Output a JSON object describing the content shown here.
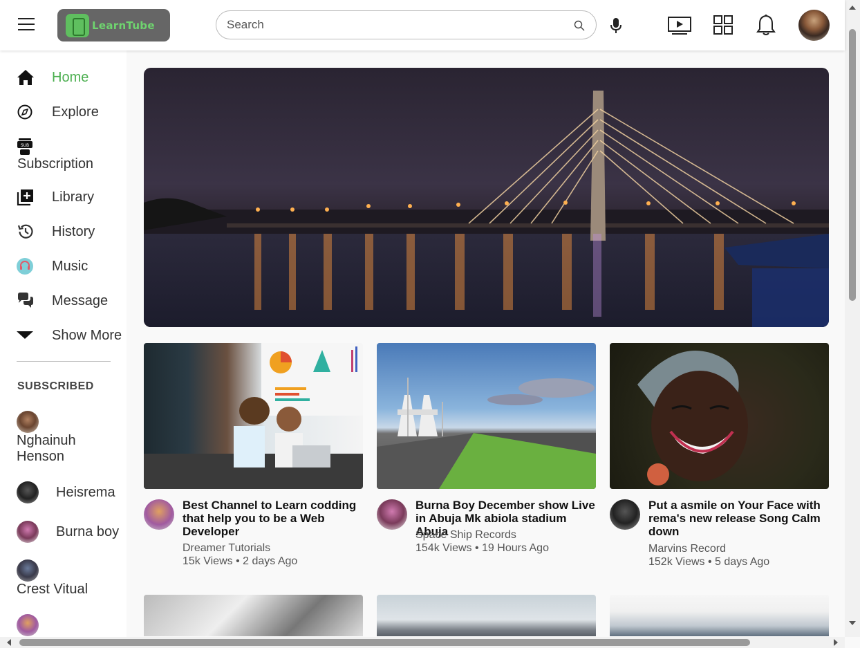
{
  "header": {
    "logo_text": "LearnTube",
    "search_placeholder": "Search"
  },
  "sidebar": {
    "items": [
      {
        "label": "Home",
        "icon": "home-icon",
        "active": true
      },
      {
        "label": "Explore",
        "icon": "compass-icon"
      },
      {
        "label": "Subscription",
        "icon": "subscription-icon"
      },
      {
        "label": "Library",
        "icon": "library-add-icon"
      },
      {
        "label": "History",
        "icon": "history-icon"
      },
      {
        "label": "Music",
        "icon": "headphones-icon"
      },
      {
        "label": "Message",
        "icon": "chat-icon"
      },
      {
        "label": "Show More",
        "icon": "caret-down-icon"
      }
    ],
    "subscribed_title": "SUBSCRIBED",
    "subscriptions": [
      {
        "name": "Nghainuh Henson"
      },
      {
        "name": "Heisrema"
      },
      {
        "name": "Burna boy"
      },
      {
        "name": "Crest Vitual"
      }
    ]
  },
  "videos": [
    {
      "title": "Best Channel to Learn codding that help you to be a Web Developer",
      "channel": "Dreamer Tutorials",
      "meta": "15k Views • 2 days Ago"
    },
    {
      "title": "Burna Boy December show Live in Abuja Mk abiola stadium Abuja",
      "channel": "Space Ship Records",
      "meta": "154k Views • 19 Hours Ago"
    },
    {
      "title": "Put a asmile on Your Face with rema's new release Song Calm down",
      "channel": "Marvins Record",
      "meta": "152k Views • 5 days Ago"
    }
  ],
  "colors": {
    "accent": "#4caf50",
    "logo_bg": "#666666"
  }
}
